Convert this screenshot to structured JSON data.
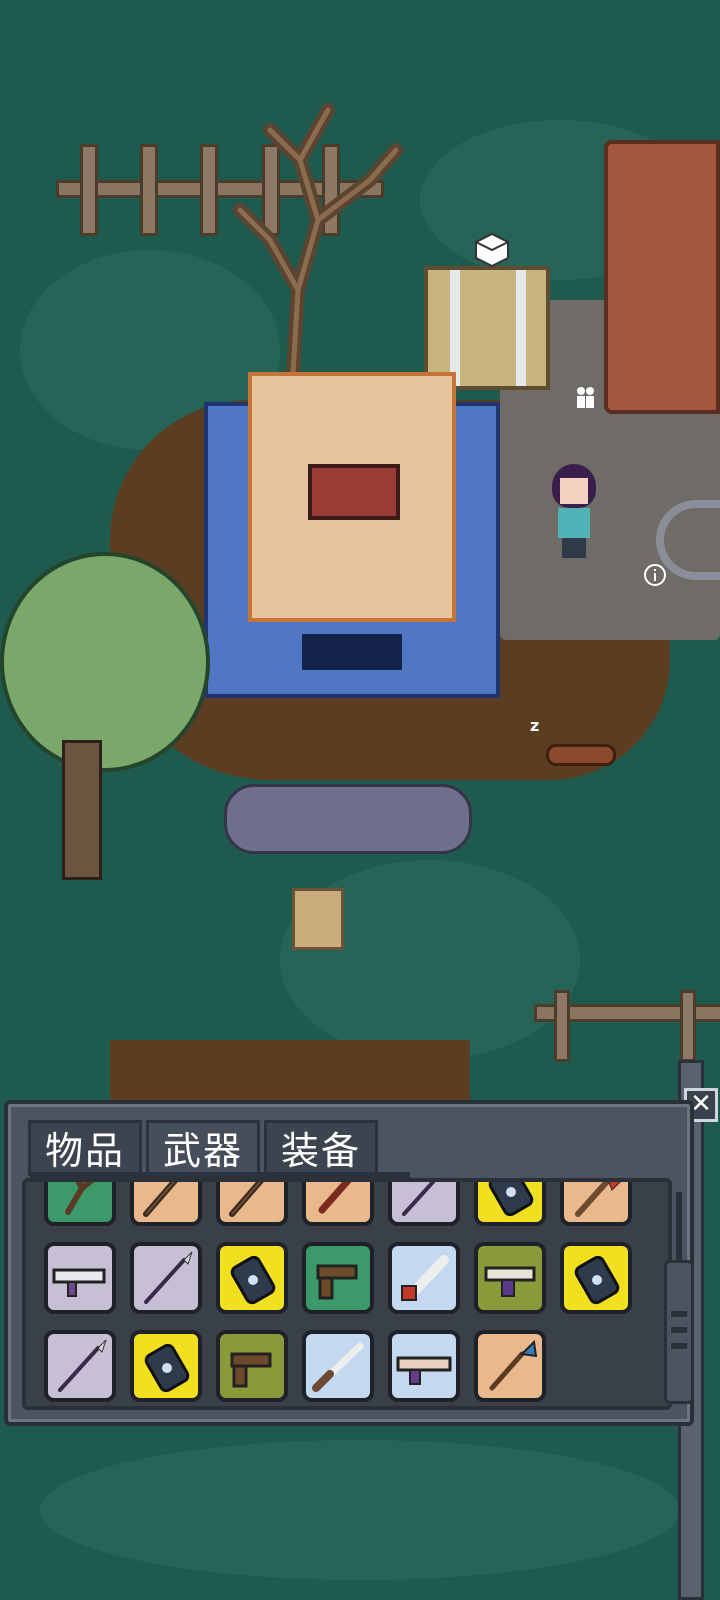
{
  "inventory": {
    "tabs": [
      {
        "label": "物品",
        "active": false
      },
      {
        "label": "武器",
        "active": true
      },
      {
        "label": "装备",
        "active": false
      }
    ],
    "close_icon": "close-x-icon",
    "rows": [
      [
        {
          "icon": "stick-icon",
          "color": "green"
        },
        {
          "icon": "staff-icon",
          "color": "peach"
        },
        {
          "icon": "staff-icon",
          "color": "peach"
        },
        {
          "icon": "torch-icon",
          "color": "peach"
        },
        {
          "icon": "spear-icon",
          "color": "gray"
        },
        {
          "icon": "grenade-icon",
          "color": "yellow"
        },
        {
          "icon": "axe-icon",
          "color": "peach"
        }
      ],
      [
        {
          "icon": "rifle-icon",
          "color": "gray"
        },
        {
          "icon": "spear-icon",
          "color": "gray"
        },
        {
          "icon": "grenade-icon",
          "color": "yellow"
        },
        {
          "icon": "pistol-icon",
          "color": "green"
        },
        {
          "icon": "chainsaw-icon",
          "color": "blue"
        },
        {
          "icon": "smg-icon",
          "color": "olive"
        },
        {
          "icon": "grenade-icon",
          "color": "yellow"
        }
      ],
      [
        {
          "icon": "spear-icon",
          "color": "gray"
        },
        {
          "icon": "grenade-icon",
          "color": "yellow"
        },
        {
          "icon": "pistol-icon",
          "color": "olive"
        },
        {
          "icon": "shotgun-icon",
          "color": "blue"
        },
        {
          "icon": "laser-rifle-icon",
          "color": "blue"
        },
        {
          "icon": "shovel-icon",
          "color": "peach"
        }
      ]
    ]
  },
  "scene": {
    "info_icon": "info-circle-icon",
    "sleep_marker": "z"
  }
}
